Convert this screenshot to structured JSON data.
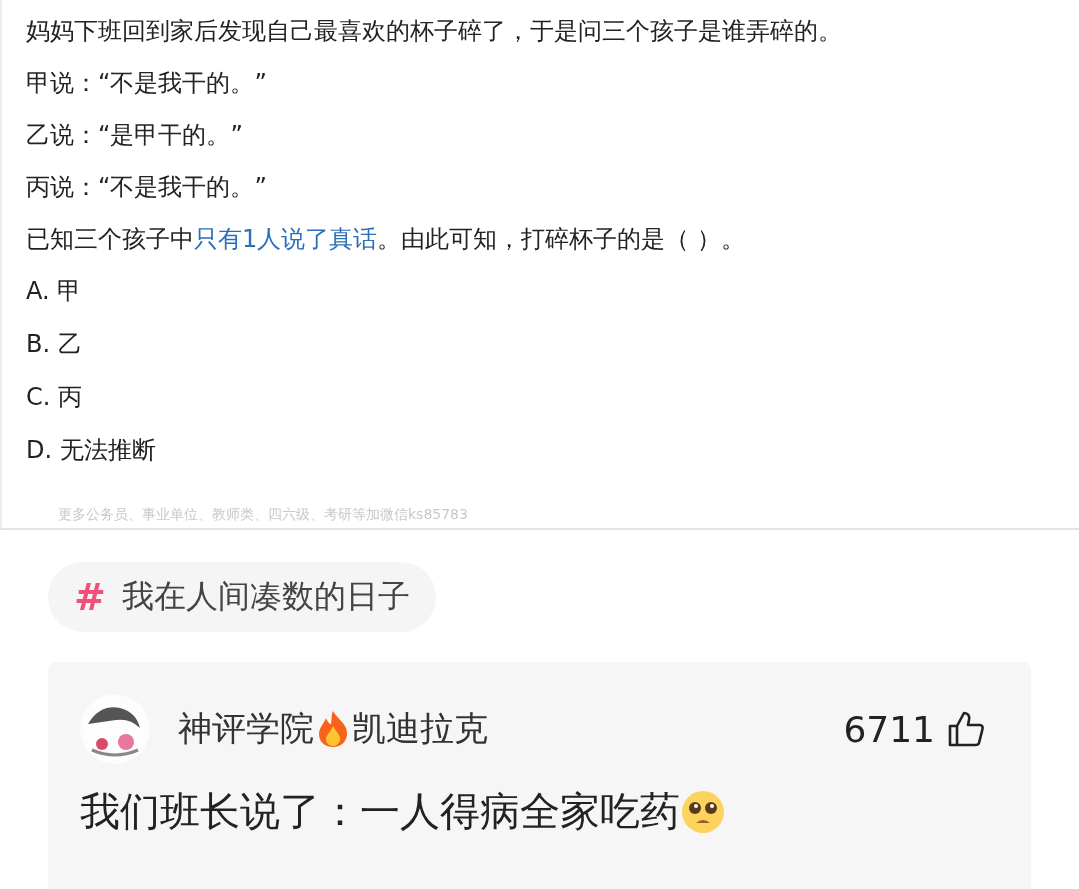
{
  "quiz": {
    "question": "妈妈下班回到家后发现自己最喜欢的杯子碎了，于是问三个孩子是谁弄碎的。",
    "statements": [
      "甲说：“不是我干的。”",
      "乙说：“是甲干的。”",
      "丙说：“不是我干的。”"
    ],
    "condition": [
      {
        "text": "已知三个孩子中",
        "highlight": false
      },
      {
        "text": "只有1人说了真话",
        "highlight": true
      },
      {
        "text": "。由此可知，打碎杯子的是（ ）。",
        "highlight": false
      }
    ],
    "options": [
      "A. 甲",
      "B. 乙",
      "C. 丙",
      "D. 无法推断"
    ],
    "footer": "更多公务员、事业单位、教师类、四六级、考研等加微信ks85783"
  },
  "topic": {
    "symbol": "#",
    "label": "我在人间凑数的日子"
  },
  "comment": {
    "author_group": "神评学院",
    "author_name": "凯迪拉克",
    "likes": "6711",
    "text": "我们班长说了：一人得病全家吃药"
  }
}
